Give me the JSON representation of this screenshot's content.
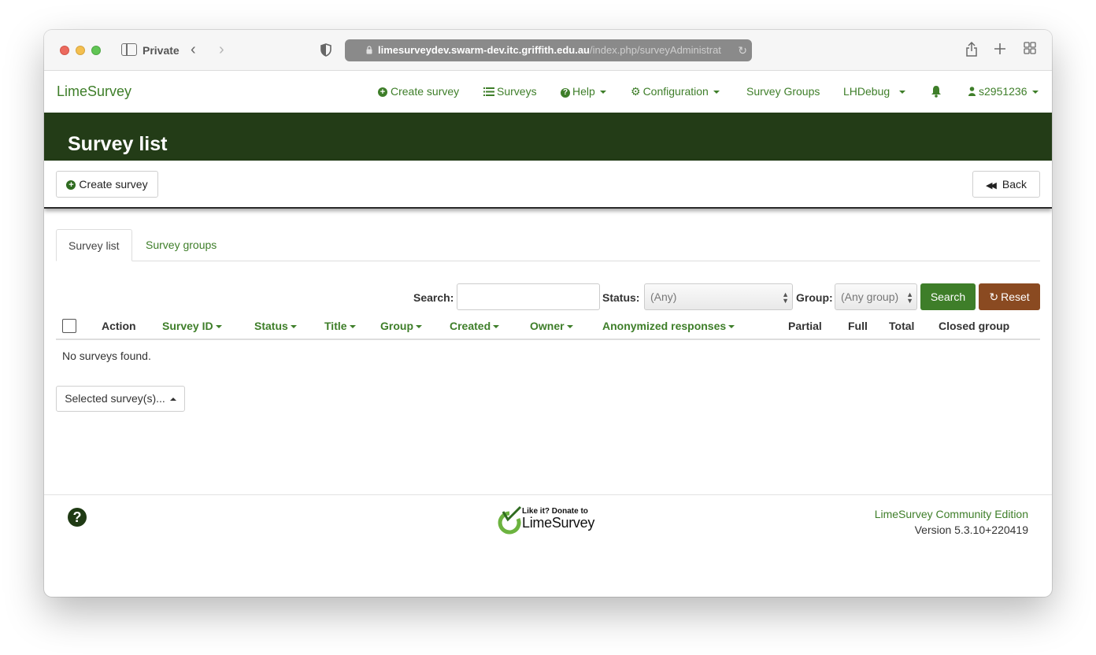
{
  "browser": {
    "private_label": "Private",
    "url_host": "limesurveydev.swarm-dev.itc.griffith.edu.au",
    "url_path": "/index.php/surveyAdministrat"
  },
  "navbar": {
    "brand": "LimeSurvey",
    "items": {
      "create_survey": "Create survey",
      "surveys": "Surveys",
      "help": "Help",
      "configuration": "Configuration",
      "survey_groups": "Survey Groups",
      "debug": "LHDebug",
      "user": "s2951236"
    }
  },
  "page": {
    "title": "Survey list"
  },
  "toolbar": {
    "create_label": "Create survey",
    "back_label": "Back"
  },
  "tabs": [
    {
      "label": "Survey list",
      "active": true
    },
    {
      "label": "Survey groups",
      "active": false
    }
  ],
  "filters": {
    "search_label": "Search:",
    "search_value": "",
    "status_label": "Status:",
    "status_value": "(Any)",
    "group_label": "Group:",
    "group_value": "(Any group)",
    "search_button": "Search",
    "reset_button": "Reset"
  },
  "table": {
    "columns": {
      "action": "Action",
      "survey_id": "Survey ID",
      "status": "Status",
      "title": "Title",
      "group": "Group",
      "created": "Created",
      "owner": "Owner",
      "anonymized": "Anonymized responses",
      "partial": "Partial",
      "full": "Full",
      "total": "Total",
      "closed_group": "Closed group"
    },
    "empty_message": "No surveys found.",
    "selected_button": "Selected survey(s)..."
  },
  "footer": {
    "donate_top": "Like it? Donate to",
    "donate_bottom": "LimeSurvey",
    "edition": "LimeSurvey Community Edition",
    "version": "Version 5.3.10+220419"
  },
  "colors": {
    "accent_green": "#3e7e29",
    "header_dark_green": "#233c17",
    "reset_brown": "#8a4a21"
  }
}
